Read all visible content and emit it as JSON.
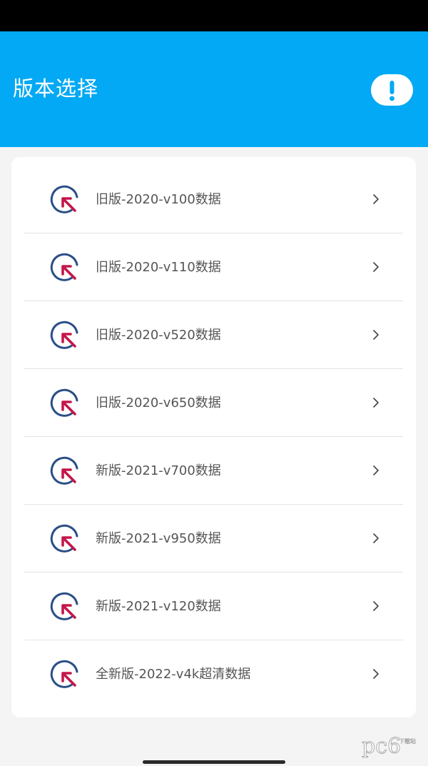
{
  "header": {
    "title": "版本选择",
    "background_color": "#03a9f4",
    "info_icon": "exclamation-icon"
  },
  "list": {
    "items": [
      {
        "label": "旧版-2020-v100数据"
      },
      {
        "label": "旧版-2020-v110数据"
      },
      {
        "label": "旧版-2020-v520数据"
      },
      {
        "label": "旧版-2020-v650数据"
      },
      {
        "label": "新版-2021-v700数据"
      },
      {
        "label": "新版-2021-v950数据"
      },
      {
        "label": "新版-2021-v120数据"
      },
      {
        "label": "全新版-2022-v4k超清数据"
      }
    ],
    "item_icon": "arrow-gauge-icon",
    "trailing_icon": "chevron-right-icon"
  },
  "colors": {
    "icon_ring": "#2b4f86",
    "icon_arrow": "#c4164a",
    "label_text": "#555555",
    "divider": "#e3e3e3"
  },
  "watermark": {
    "text": "pc6",
    "sub": "下载站"
  }
}
